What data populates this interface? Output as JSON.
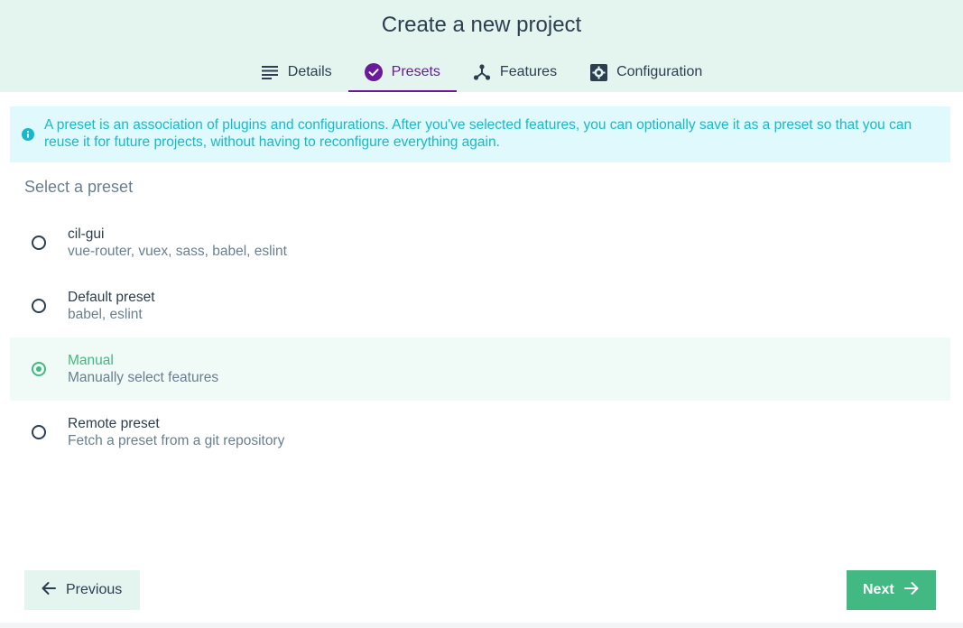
{
  "header": {
    "title": "Create a new project",
    "tabs": [
      {
        "label": "Details",
        "icon": "list-icon",
        "active": false
      },
      {
        "label": "Presets",
        "icon": "check-circle-icon",
        "active": true
      },
      {
        "label": "Features",
        "icon": "fork-icon",
        "active": false
      },
      {
        "label": "Configuration",
        "icon": "gear-icon",
        "active": false
      }
    ]
  },
  "info": {
    "icon": "info-icon",
    "text": "A preset is an association of plugins and configurations. After you've selected features, you can optionally save it as a preset so that you can reuse it for future projects, without having to reconfigure everything again."
  },
  "presets": {
    "section_title": "Select a preset",
    "items": [
      {
        "name": "cil-gui",
        "description": "vue-router, vuex, sass, babel, eslint",
        "selected": false
      },
      {
        "name": "Default preset",
        "description": "babel, eslint",
        "selected": false
      },
      {
        "name": "Manual",
        "description": "Manually select features",
        "selected": true
      },
      {
        "name": "Remote preset",
        "description": "Fetch a preset from a git repository",
        "selected": false
      }
    ]
  },
  "footer": {
    "previous_label": "Previous",
    "next_label": "Next"
  },
  "colors": {
    "accent_green": "#42b983",
    "accent_purple": "#6a1b9a",
    "header_bg": "#e4f5ef",
    "info_bg": "#e0f9fc",
    "info_text": "#16b9cc"
  }
}
